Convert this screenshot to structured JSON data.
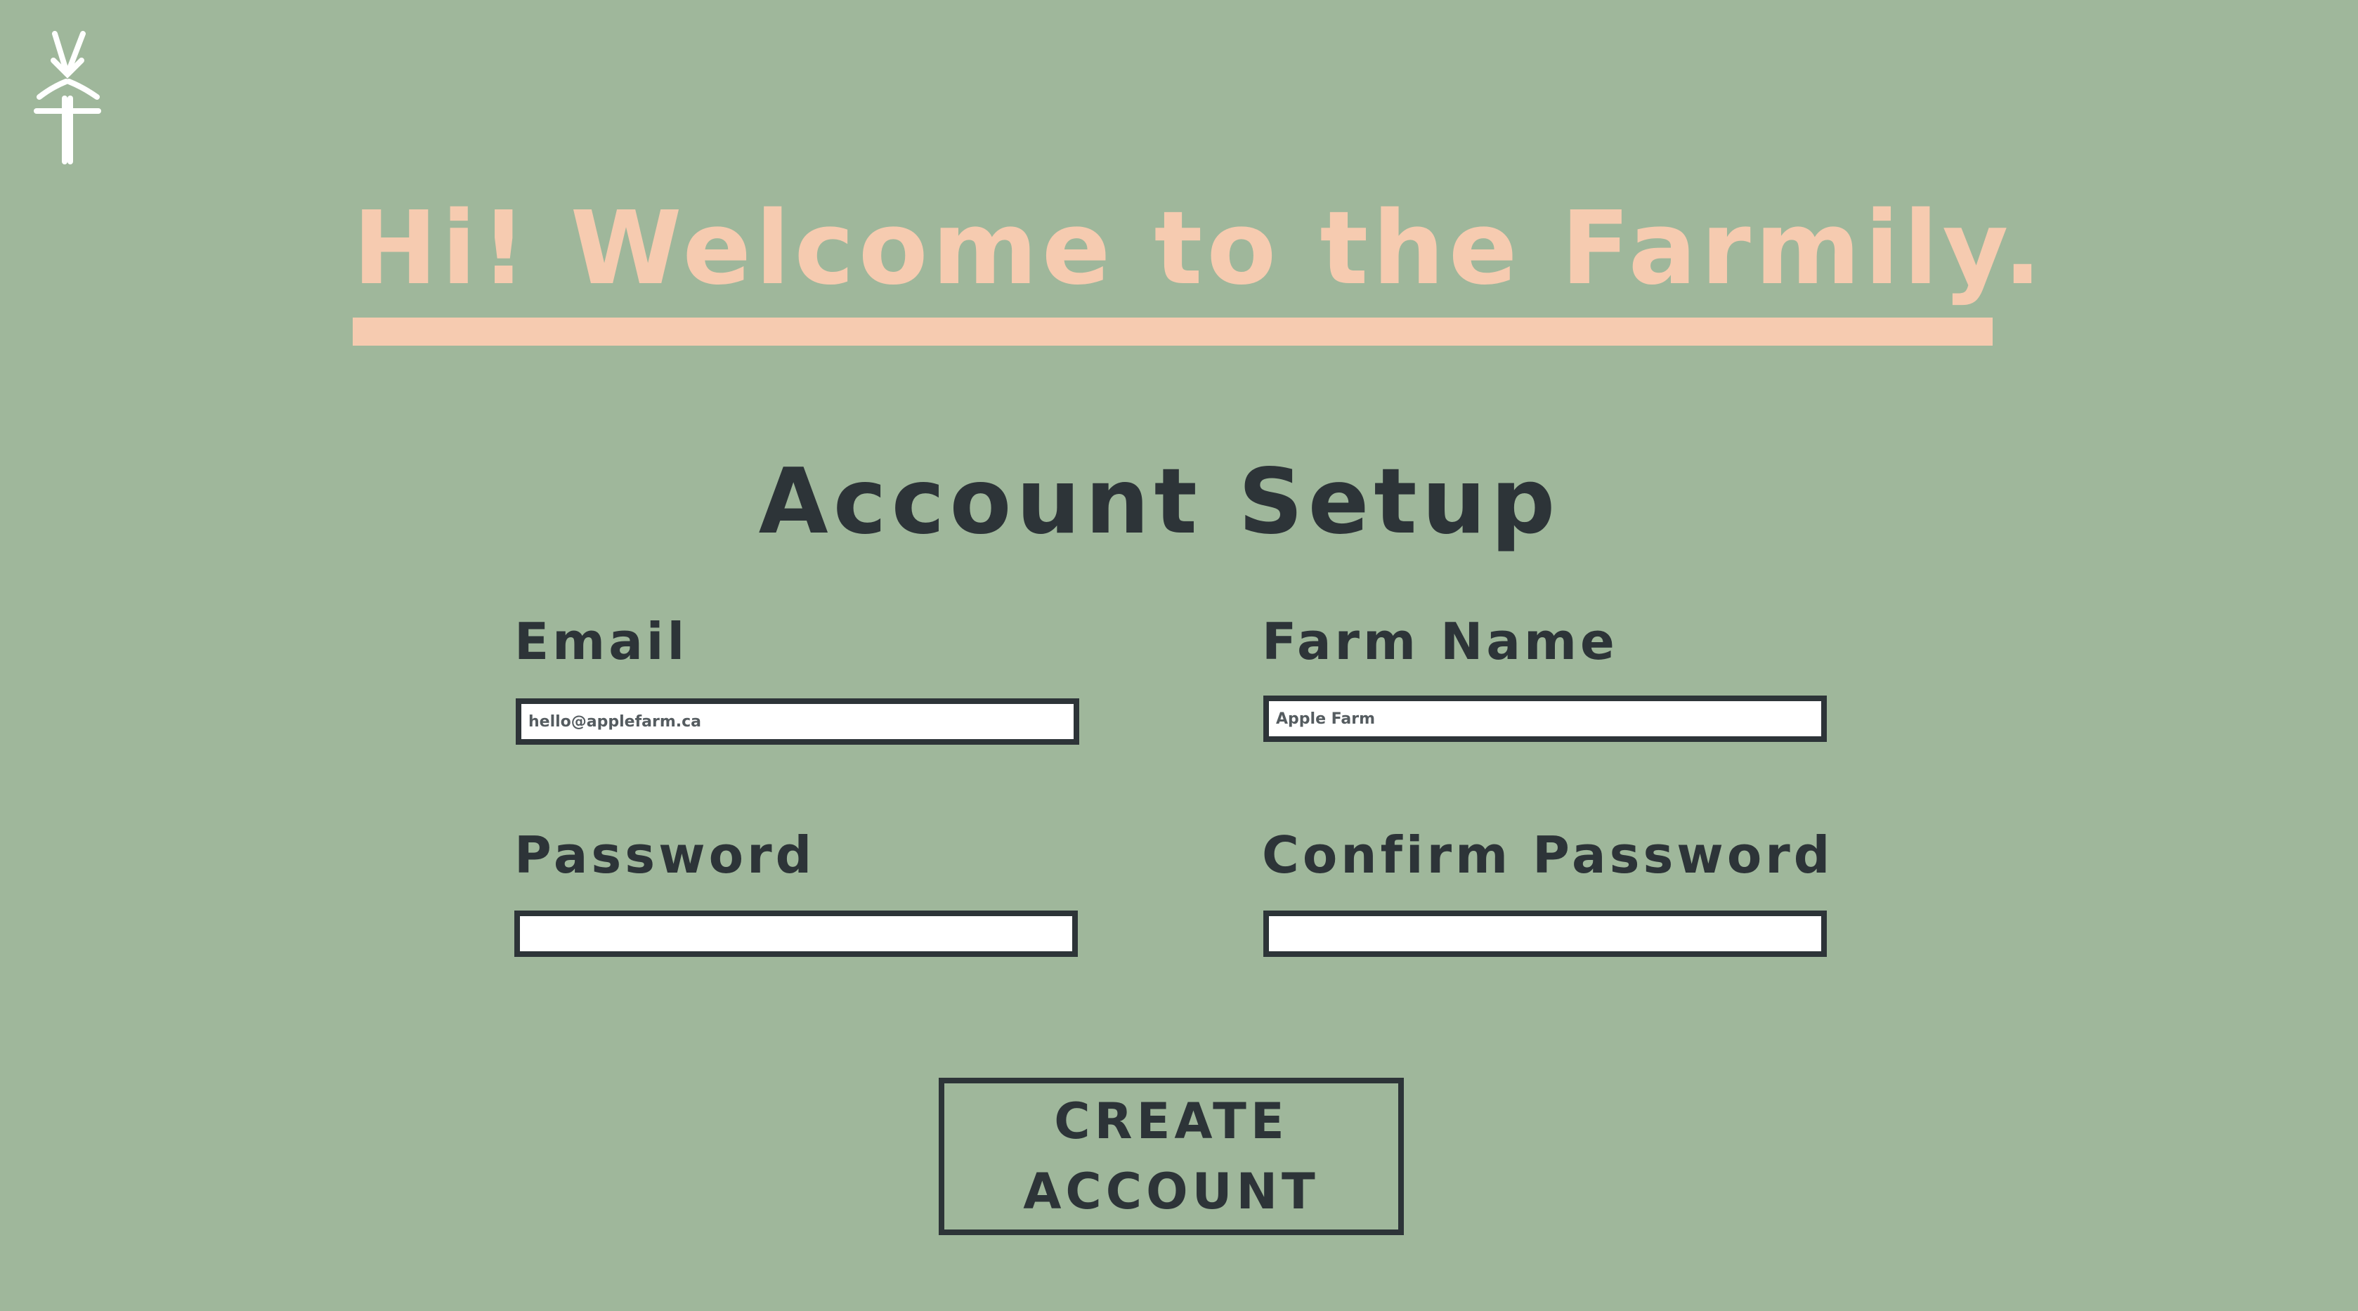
{
  "colors": {
    "background": "#9fb79b",
    "accent": "#f6cbb0",
    "text": "#2d3438",
    "input_bg": "#ffffff"
  },
  "logo": {
    "icon": "wheat-sprout-icon"
  },
  "header": {
    "welcome": "Hi! Welcome to the Farmily."
  },
  "form": {
    "title": "Account Setup",
    "email": {
      "label": "Email",
      "value": "hello@applefarm.ca"
    },
    "farm_name": {
      "label": "Farm Name",
      "value": "Apple Farm"
    },
    "password": {
      "label": "Password",
      "value": ""
    },
    "confirm_password": {
      "label": "Confirm Password",
      "value": ""
    },
    "submit": {
      "line1": "CREATE",
      "line2": "ACCOUNT"
    }
  }
}
